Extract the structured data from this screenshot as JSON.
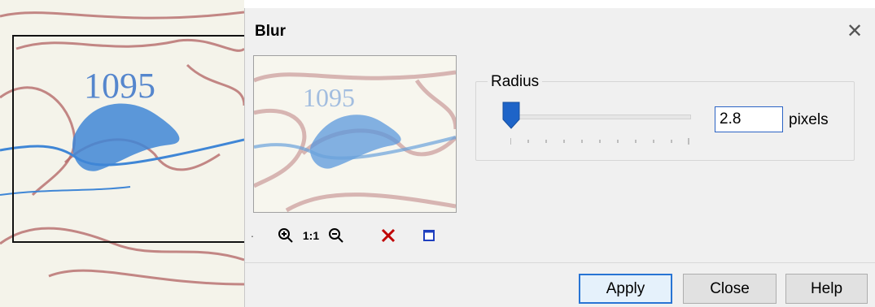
{
  "dialog": {
    "title": "Blur",
    "close_icon": "close-icon"
  },
  "map": {
    "label": "1095"
  },
  "toolbar": {
    "zoom_in_icon": "zoom-in-icon",
    "actual_size_label": "1:1",
    "zoom_out_icon": "zoom-out-icon",
    "reset_icon": "red-x-icon",
    "frame_icon": "square-frame-icon"
  },
  "radius": {
    "group_label": "Radius",
    "value": "2.8",
    "units": "pixels"
  },
  "buttons": {
    "apply": "Apply",
    "close": "Close",
    "help": "Help"
  },
  "colors": {
    "accent": "#2b63c4",
    "contour": "#b56a6a",
    "water": "#3f86d6",
    "cancel_red": "#c00000"
  }
}
